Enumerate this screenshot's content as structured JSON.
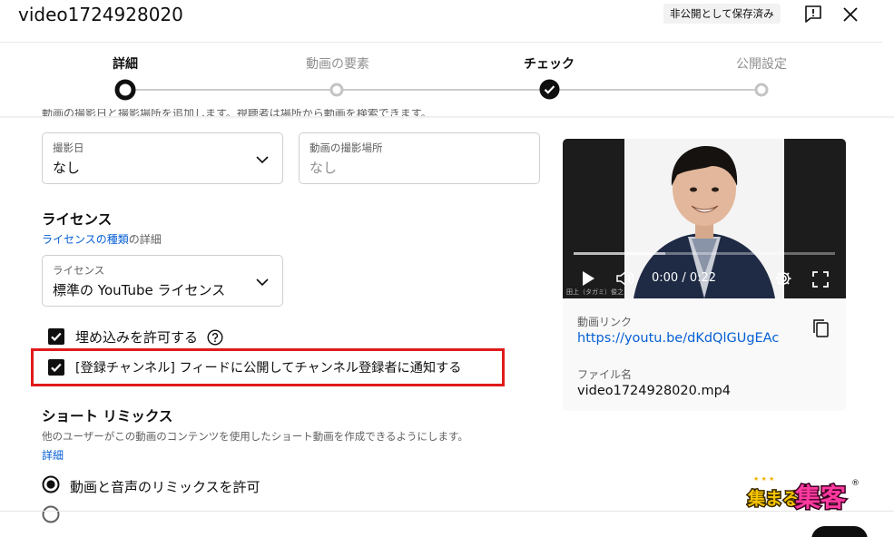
{
  "header": {
    "title": "video1724928020",
    "saved_badge": "非公開として保存済み",
    "feedback_icon": "feedback-icon",
    "close_icon": "close-icon"
  },
  "stepper": {
    "steps": [
      {
        "label": "詳細",
        "state": "current"
      },
      {
        "label": "動画の要素",
        "state": "pending"
      },
      {
        "label": "チェック",
        "state": "done"
      },
      {
        "label": "公開設定",
        "state": "pending"
      }
    ]
  },
  "form": {
    "cut_text": "動画の撮影日と撮影場所を追加します。視聴者は場所から動画を検索できます。",
    "recording_date": {
      "label": "撮影日",
      "value": "なし"
    },
    "location": {
      "label": "動画の撮影場所",
      "placeholder": "なし"
    },
    "license": {
      "title": "ライセンス",
      "link_text": "ライセンスの種類",
      "suffix": "の詳細",
      "select_label": "ライセンス",
      "select_value": "標準の YouTube ライセンス"
    },
    "allow_embedding": {
      "label": "埋め込みを許可する",
      "checked": true
    },
    "notify_subscribers": {
      "label": "[登録チャンネル] フィードに公開してチャンネル登録者に通知する",
      "checked": true
    },
    "shorts_remix": {
      "title": "ショート リミックス",
      "description": "他のユーザーがこの動画のコンテンツを使用したショート動画を作成できるようにします。",
      "details_link": "詳細",
      "option_selected": "動画と音声のリミックスを許可"
    }
  },
  "preview": {
    "time": "0:00 / 0:22",
    "progress": 0.0,
    "watermark": "田上（タガミ）俊之",
    "link_label": "動画リンク",
    "link": "https://youtu.be/dKdQlGUgEAc",
    "filename_label": "ファイル名",
    "filename": "video1724928020.mp4"
  },
  "logo": {
    "text": "集まる集客",
    "mark": "®"
  },
  "colors": {
    "accent_link": "#065fd4",
    "highlight": "#e01b1b",
    "text": "#0f0f0f",
    "secondary": "#606060"
  }
}
